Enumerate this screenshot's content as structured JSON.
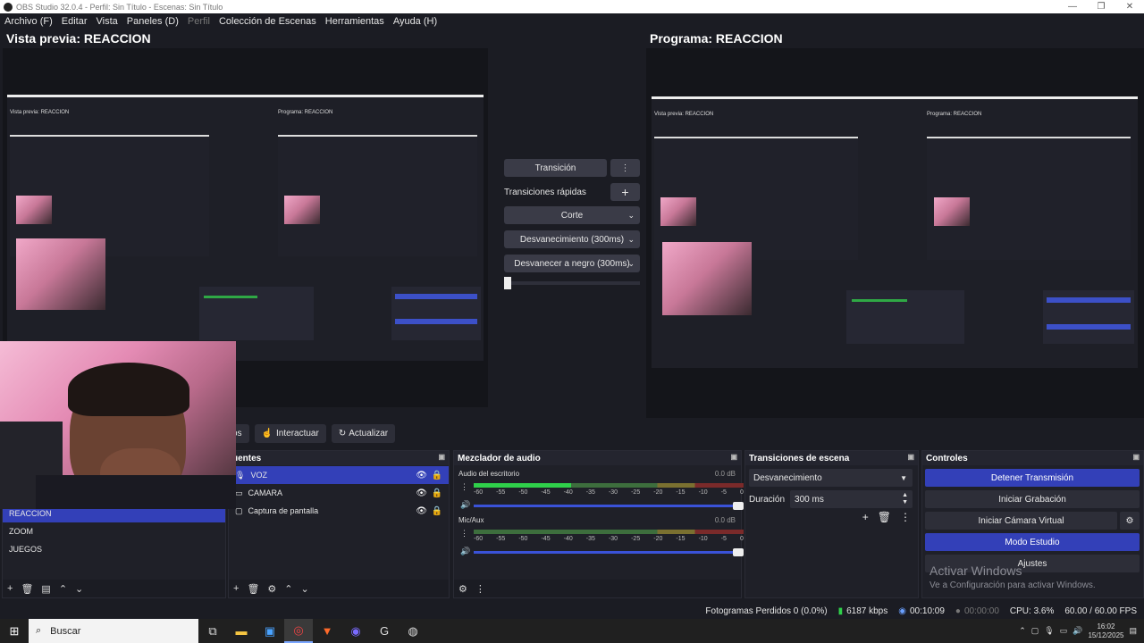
{
  "window": {
    "title": "OBS Studio 32.0.4 - Perfil: Sin Título - Escenas: Sin Título",
    "minimize": "—",
    "maximize": "❐",
    "close": "✕"
  },
  "menu": [
    "Archivo (F)",
    "Editar",
    "Vista",
    "Paneles (D)",
    "Perfil",
    "Colección de Escenas",
    "Herramientas",
    "Ayuda (H)"
  ],
  "preview": {
    "title": "Vista previa: REACCION"
  },
  "program": {
    "title": "Programa: REACCION"
  },
  "mini": {
    "preview_title": "Vista previa: REACCION",
    "program_title": "Programa: REACCION"
  },
  "transition_panel": {
    "transition_label": "Transición",
    "menu_dots": "⋮",
    "quick_label": "Transiciones rápidas",
    "add": "+",
    "items": [
      "Corte",
      "Desvanecimiento (300ms)",
      "Desvanecer a negro (300ms)"
    ],
    "chevron": "⌄"
  },
  "toolbar": {
    "props_partial": "os",
    "interact": "Interactuar",
    "refresh": "Actualizar"
  },
  "scenes": {
    "items": [
      "REACCION",
      "ZOOM",
      "JUEGOS"
    ],
    "selected": "REACCION"
  },
  "sources": {
    "header": "uentes",
    "items": [
      "VOZ",
      "CAMARA",
      "Captura de pantalla"
    ]
  },
  "mixer": {
    "header": "Mezclador de audio",
    "channels": [
      {
        "name": "Audio del escritorio",
        "db": "0.0 dB",
        "level": 0.36
      },
      {
        "name": "Mic/Aux",
        "db": "0.0 dB",
        "level": 0.0
      }
    ],
    "ticks": [
      "-60",
      "-55",
      "-50",
      "-45",
      "-40",
      "-35",
      "-30",
      "-25",
      "-20",
      "-15",
      "-10",
      "-5",
      "0"
    ]
  },
  "scene_transitions": {
    "header": "Transiciones de escena",
    "selected": "Desvanecimiento",
    "duration_label": "Duración",
    "duration_value": "300 ms"
  },
  "controls": {
    "header": "Controles",
    "stop_stream": "Detener Transmisión",
    "start_record": "Iniciar Grabación",
    "start_vcam": "Iniciar Cámara Virtual",
    "studio_mode": "Modo Estudio",
    "settings": "Ajustes"
  },
  "activate": {
    "line1": "Activar Windows",
    "line2": "Ve a Configuración para activar Windows."
  },
  "status": {
    "dropped": "Fotogramas Perdidos 0 (0.0%)",
    "bitrate": "6187 kbps",
    "stream_time": "00:10:09",
    "rec_time": "00:00:00",
    "cpu": "CPU: 3.6%",
    "fps": "60.00 / 60.00 FPS"
  },
  "taskbar": {
    "search": "Buscar",
    "time": "16:02",
    "date": "15/12/2025"
  },
  "colors": {
    "accent": "#3340b8",
    "meter_green": "#2fd04a",
    "bg": "#1b1c23"
  }
}
